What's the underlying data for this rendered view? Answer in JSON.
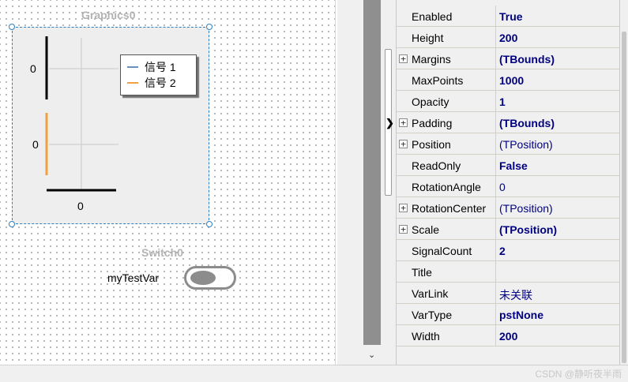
{
  "designer": {
    "graphics": {
      "name": "Graphics0",
      "y_tick_label": "0",
      "x_tick_label": "0",
      "signal_count": 2,
      "legend": [
        {
          "label": "信号 1",
          "color": "#6a8fbf"
        },
        {
          "label": "信号 2",
          "color": "#f0a040"
        }
      ]
    },
    "switch": {
      "name": "Switch0",
      "label": "myTestVar"
    }
  },
  "inspector": {
    "selected_row": "Padding",
    "properties": [
      {
        "name": "Enabled",
        "value": "True",
        "expandable": false,
        "bold": true
      },
      {
        "name": "Height",
        "value": "200",
        "expandable": false,
        "bold": true
      },
      {
        "name": "Margins",
        "value": "(TBounds)",
        "expandable": true,
        "bold": true
      },
      {
        "name": "MaxPoints",
        "value": "1000",
        "expandable": false,
        "bold": true
      },
      {
        "name": "Opacity",
        "value": "1",
        "expandable": false,
        "bold": true
      },
      {
        "name": "Padding",
        "value": "(TBounds)",
        "expandable": true,
        "bold": true
      },
      {
        "name": "Position",
        "value": "(TPosition)",
        "expandable": true,
        "bold": false
      },
      {
        "name": "ReadOnly",
        "value": "False",
        "expandable": false,
        "bold": true
      },
      {
        "name": "RotationAngle",
        "value": "0",
        "expandable": false,
        "bold": false
      },
      {
        "name": "RotationCenter",
        "value": "(TPosition)",
        "expandable": true,
        "bold": false
      },
      {
        "name": "Scale",
        "value": "(TPosition)",
        "expandable": true,
        "bold": true
      },
      {
        "name": "SignalCount",
        "value": "2",
        "expandable": false,
        "bold": true
      },
      {
        "name": "Title",
        "value": "",
        "expandable": false,
        "bold": false
      },
      {
        "name": "VarLink",
        "value": "未关联",
        "expandable": false,
        "bold": false
      },
      {
        "name": "VarType",
        "value": "pstNone",
        "expandable": false,
        "bold": true
      },
      {
        "name": "Width",
        "value": "200",
        "expandable": false,
        "bold": true
      }
    ]
  },
  "icons": {
    "expand": "plus-box-icon",
    "row_pointer": "row-pointer-icon",
    "scroll_down": "chevron-down-icon"
  },
  "status": {
    "watermark": "CSDN @静听夜半雨"
  }
}
